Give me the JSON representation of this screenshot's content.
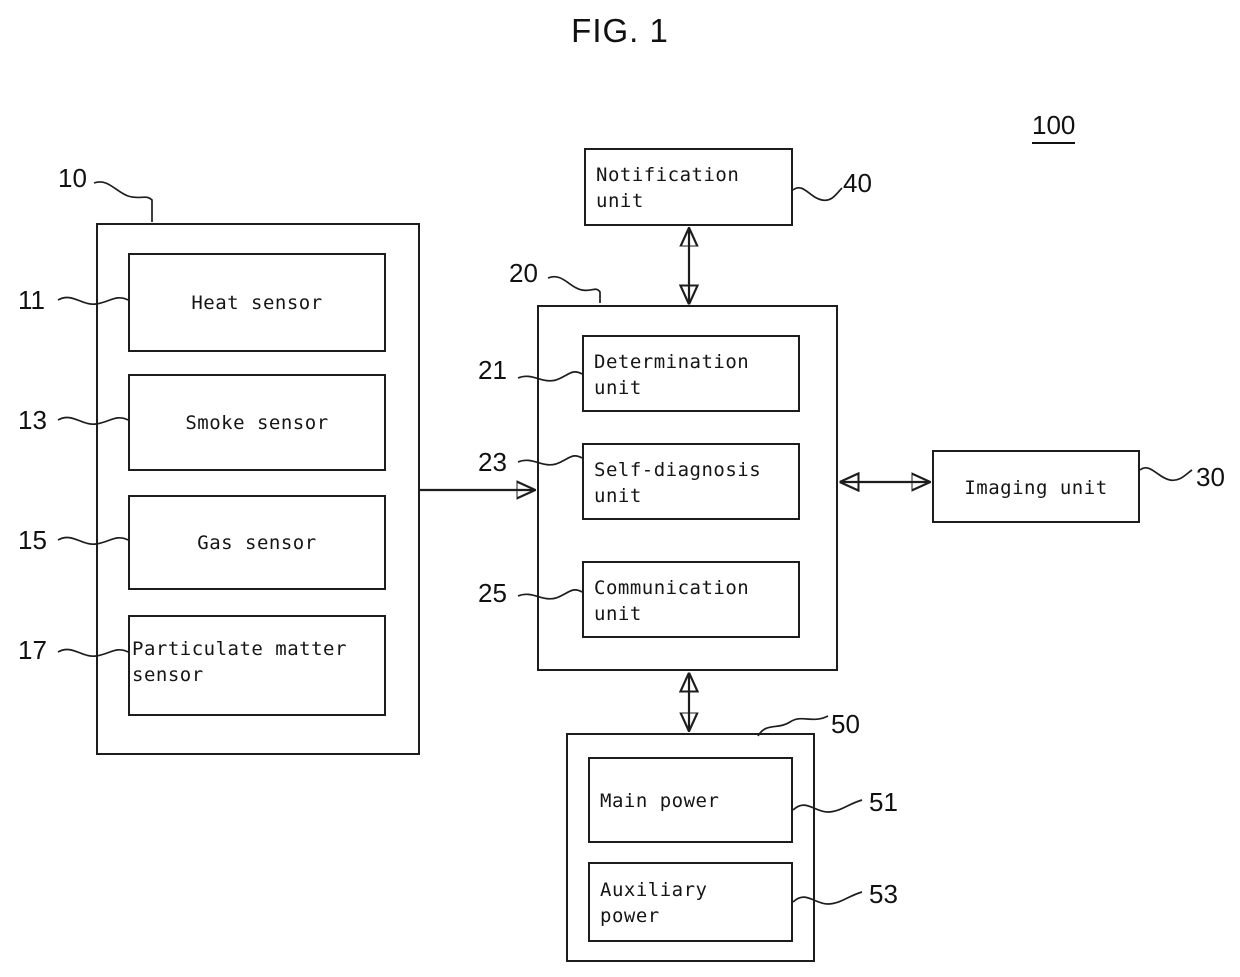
{
  "figure": {
    "title": "FIG. 1",
    "system_ref": "100"
  },
  "sensor_group": {
    "ref": "10",
    "sensors": [
      {
        "ref": "11",
        "label": "Heat sensor",
        "align": "center"
      },
      {
        "ref": "13",
        "label": "Smoke sensor",
        "align": "center"
      },
      {
        "ref": "15",
        "label": "Gas sensor",
        "align": "center"
      },
      {
        "ref": "17",
        "label": "Particulate matter\nsensor",
        "align": "left"
      }
    ]
  },
  "control_unit": {
    "ref": "20",
    "modules": [
      {
        "ref": "21",
        "label": "Determination\nunit"
      },
      {
        "ref": "23",
        "label": "Self-diagnosis\nunit"
      },
      {
        "ref": "25",
        "label": "Communication\nunit"
      }
    ]
  },
  "notification_unit": {
    "ref": "40",
    "label": "Notification\nunit"
  },
  "imaging_unit": {
    "ref": "30",
    "label": "Imaging unit"
  },
  "power_unit": {
    "ref": "50",
    "sources": [
      {
        "ref": "51",
        "label": "Main power"
      },
      {
        "ref": "53",
        "label": "Auxiliary\npower"
      }
    ]
  },
  "connections": [
    {
      "from": "sensor_group",
      "to": "control_unit",
      "arrow": "single"
    },
    {
      "from": "control_unit",
      "to": "notification_unit",
      "arrow": "double"
    },
    {
      "from": "control_unit",
      "to": "imaging_unit",
      "arrow": "double"
    },
    {
      "from": "control_unit",
      "to": "power_unit",
      "arrow": "double"
    }
  ],
  "colors": {
    "stroke": "#1d1d1d",
    "background": "#ffffff"
  }
}
